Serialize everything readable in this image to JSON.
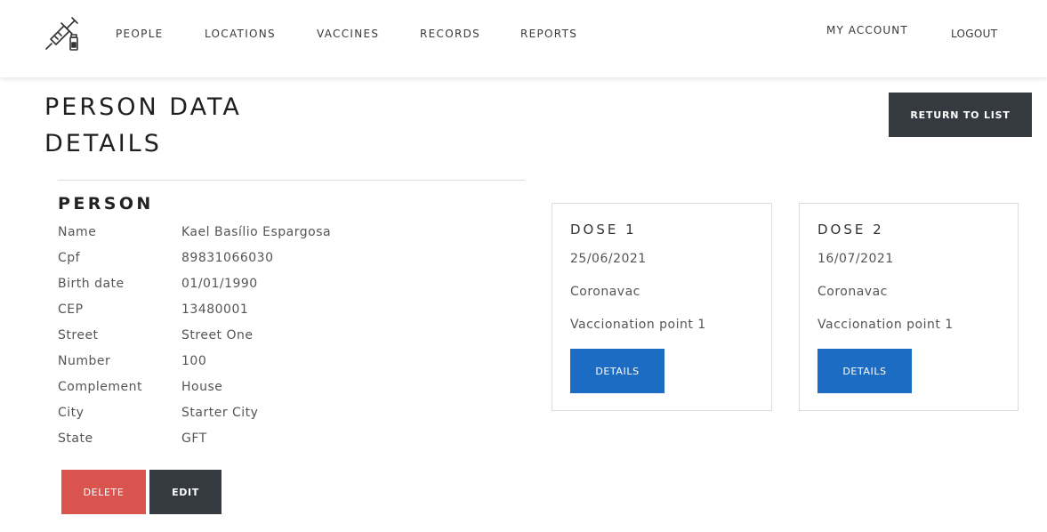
{
  "nav": {
    "items": [
      "PEOPLE",
      "LOCATIONS",
      "VACCINES",
      "RECORDS",
      "REPORTS"
    ],
    "my_account": "MY ACCOUNT",
    "logout": "LOGOUT"
  },
  "page": {
    "title_line1": "PERSON DATA",
    "title_line2": "DETAILS",
    "return_label": "RETURN TO LIST"
  },
  "person": {
    "section_title": "PERSON",
    "fields": [
      {
        "label": "Name",
        "value": "Kael Basílio Espargosa"
      },
      {
        "label": "Cpf",
        "value": "89831066030"
      },
      {
        "label": "Birth date",
        "value": "01/01/1990"
      },
      {
        "label": "CEP",
        "value": "13480001"
      },
      {
        "label": "Street",
        "value": "Street One"
      },
      {
        "label": "Number",
        "value": "100"
      },
      {
        "label": "Complement",
        "value": "House"
      },
      {
        "label": "City",
        "value": "Starter City"
      },
      {
        "label": "State",
        "value": "GFT"
      }
    ],
    "delete_label": "DELETE",
    "edit_label": "EDIT"
  },
  "doses": [
    {
      "title": "DOSE 1",
      "date": "25/06/2021",
      "vaccine": "Coronavac",
      "location": "Vaccionation point 1",
      "button": "DETAILS"
    },
    {
      "title": "DOSE 2",
      "date": "16/07/2021",
      "vaccine": "Coronavac",
      "location": "Vaccionation point 1",
      "button": "DETAILS"
    }
  ],
  "icons": {
    "logo": "syringe-vial-icon"
  },
  "colors": {
    "dark_button": "#343a40",
    "delete_button": "#d9534f",
    "details_button": "#1d6cc4"
  }
}
